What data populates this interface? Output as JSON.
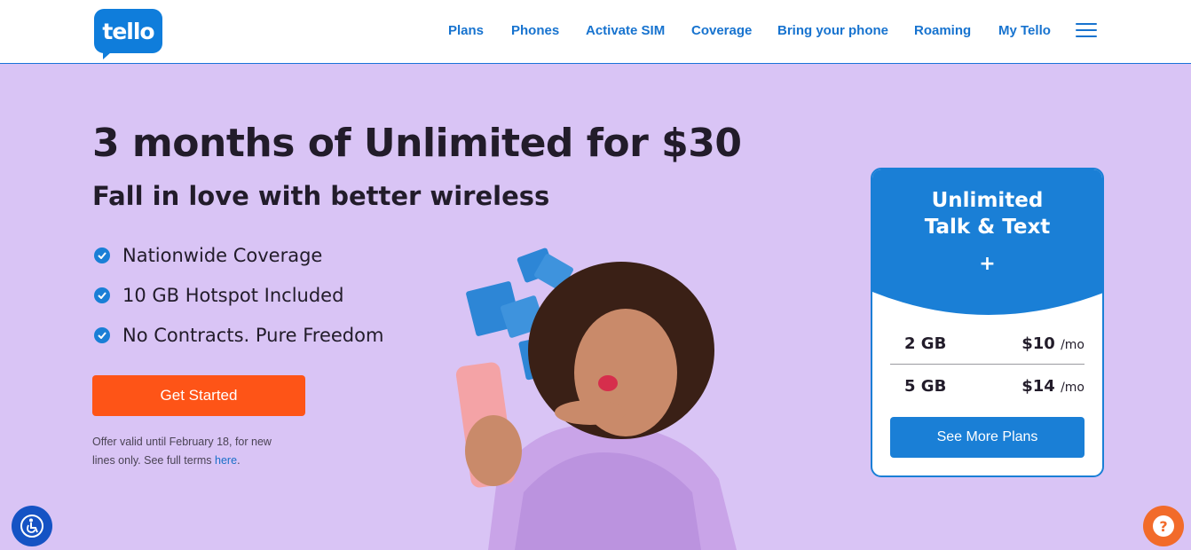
{
  "header": {
    "logo_text": "tello",
    "nav": [
      {
        "label": "Plans"
      },
      {
        "label": "Phones"
      },
      {
        "label": "Activate SIM"
      },
      {
        "label": "Coverage"
      },
      {
        "label": "Bring your phone"
      },
      {
        "label": "Roaming"
      },
      {
        "label": "My Tello"
      }
    ]
  },
  "hero": {
    "headline": "3 months of Unlimited for $30",
    "subhead": "Fall in love with better wireless",
    "features": [
      {
        "label": "Nationwide Coverage"
      },
      {
        "label": "10 GB Hotspot Included"
      },
      {
        "label": "No Contracts. Pure Freedom"
      }
    ],
    "cta_label": "Get Started",
    "terms_line1": "Offer valid until February 18, for new",
    "terms_line2": "lines only. See full terms ",
    "terms_link": "here",
    "terms_end": "."
  },
  "plan_card": {
    "title_line1": "Unlimited",
    "title_line2": "Talk & Text",
    "plus": "+",
    "plans": [
      {
        "data": "2 GB",
        "price": "$10",
        "unit": "/mo"
      },
      {
        "data": "5 GB",
        "price": "$14",
        "unit": "/mo"
      }
    ],
    "button_label": "See More Plans"
  },
  "colors": {
    "brand_blue": "#1a7fd6",
    "cta_orange": "#fe5417",
    "page_background": "#d9c4f5"
  },
  "icons": {
    "accessibility": "accessibility-icon",
    "help": "help-question-icon",
    "menu": "hamburger-menu-icon",
    "check": "check-circle-icon"
  }
}
